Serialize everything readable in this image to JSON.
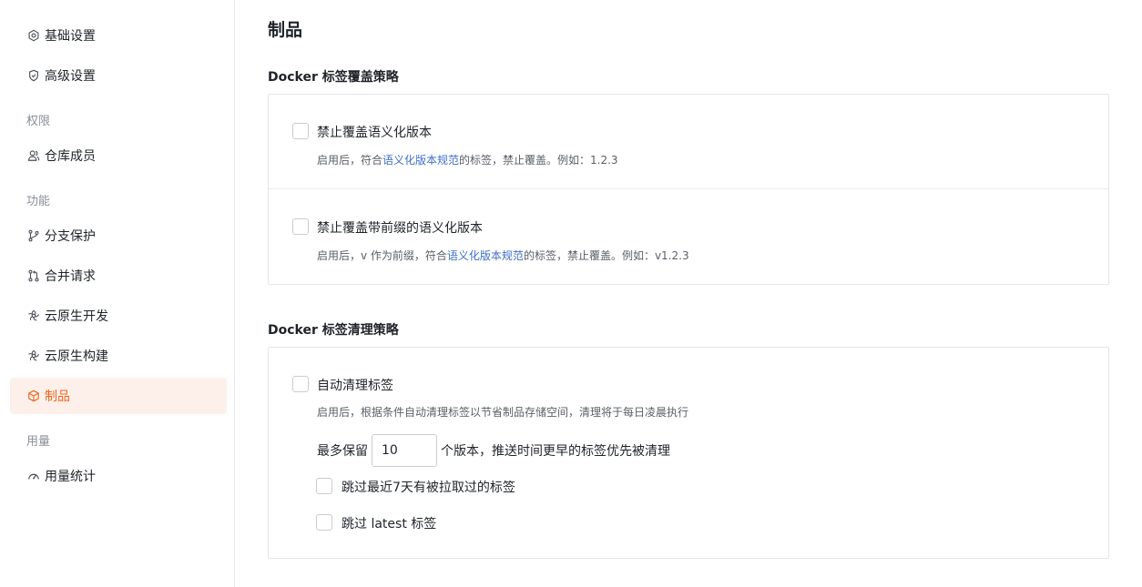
{
  "sidebar": {
    "items": [
      {
        "label": "基础设置",
        "icon": "hexagon-settings-icon"
      },
      {
        "label": "高级设置",
        "icon": "shield-icon"
      },
      {
        "label": "仓库成员",
        "icon": "users-icon"
      },
      {
        "label": "分支保护",
        "icon": "branch-icon"
      },
      {
        "label": "合并请求",
        "icon": "merge-request-icon"
      },
      {
        "label": "云原生开发",
        "icon": "cloud-native-icon"
      },
      {
        "label": "云原生构建",
        "icon": "cloud-native-icon"
      },
      {
        "label": "制品",
        "icon": "package-icon",
        "active": true
      },
      {
        "label": "用量统计",
        "icon": "gauge-icon"
      }
    ],
    "groups": {
      "permissions": "权限",
      "features": "功能",
      "usage": "用量"
    }
  },
  "main": {
    "title": "制品",
    "overwrite_policy": {
      "title": "Docker 标签覆盖策略",
      "semver": {
        "label": "禁止覆盖语义化版本",
        "desc_prefix": "启用后，符合",
        "desc_link": "语义化版本规范",
        "desc_suffix": "的标签，禁止覆盖。例如：1.2.3",
        "checked": false
      },
      "prefixed_semver": {
        "label": "禁止覆盖带前缀的语义化版本",
        "desc_prefix": "启用后，v 作为前缀，符合",
        "desc_link": "语义化版本规范",
        "desc_suffix": "的标签，禁止覆盖。例如：v1.2.3",
        "checked": false
      }
    },
    "cleanup_policy": {
      "title": "Docker 标签清理策略",
      "auto_cleanup": {
        "label": "自动清理标签",
        "desc": "启用后，根据条件自动清理标签以节省制品存储空间，清理将于每日凌晨执行",
        "checked": false
      },
      "retain_prefix": "最多保留",
      "retain_value": "10",
      "retain_suffix": "个版本，推送时间更早的标签优先被清理",
      "skip_recent": {
        "label": "跳过最近7天有被拉取过的标签",
        "checked": false
      },
      "skip_latest": {
        "label": "跳过 latest 标签",
        "checked": false
      }
    }
  },
  "colors": {
    "accent": "#f0651e",
    "active_bg": "#fdf0ea",
    "link": "#3f6ec8"
  }
}
